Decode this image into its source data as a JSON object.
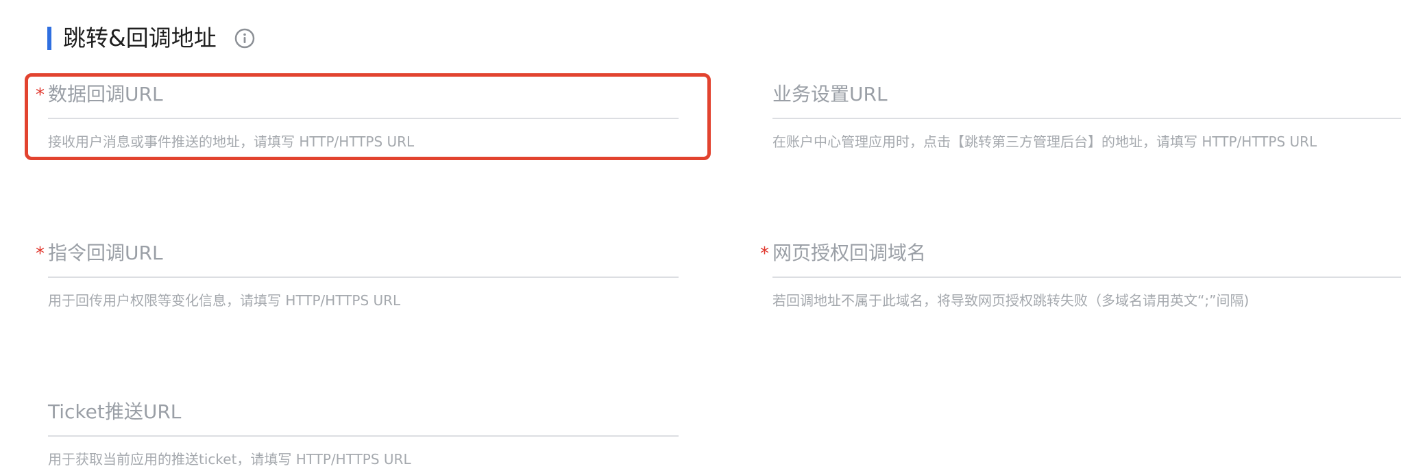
{
  "section": {
    "title": "跳转&回调地址",
    "accent_color": "#2f6fe0",
    "info_icon": "info-circle-icon"
  },
  "highlight": {
    "color": "#e2432f",
    "target": "data-callback-url"
  },
  "required_marker": "*",
  "fields": {
    "data_callback_url": {
      "label": "数据回调URL",
      "required": true,
      "hint": "接收用户消息或事件推送的地址，请填写 HTTP/HTTPS URL"
    },
    "business_settings_url": {
      "label": "业务设置URL",
      "required": false,
      "hint": "在账户中心管理应用时，点击【跳转第三方管理后台】的地址，请填写 HTTP/HTTPS URL"
    },
    "command_callback_url": {
      "label": "指令回调URL",
      "required": true,
      "hint": "用于回传用户权限等变化信息，请填写 HTTP/HTTPS URL"
    },
    "web_auth_callback_domain": {
      "label": "网页授权回调域名",
      "required": true,
      "hint": "若回调地址不属于此域名，将导致网页授权跳转失败（多域名请用英文“;”间隔)"
    },
    "ticket_push_url": {
      "label": "Ticket推送URL",
      "required": false,
      "hint": "用于获取当前应用的推送ticket，请填写 HTTP/HTTPS URL"
    }
  }
}
